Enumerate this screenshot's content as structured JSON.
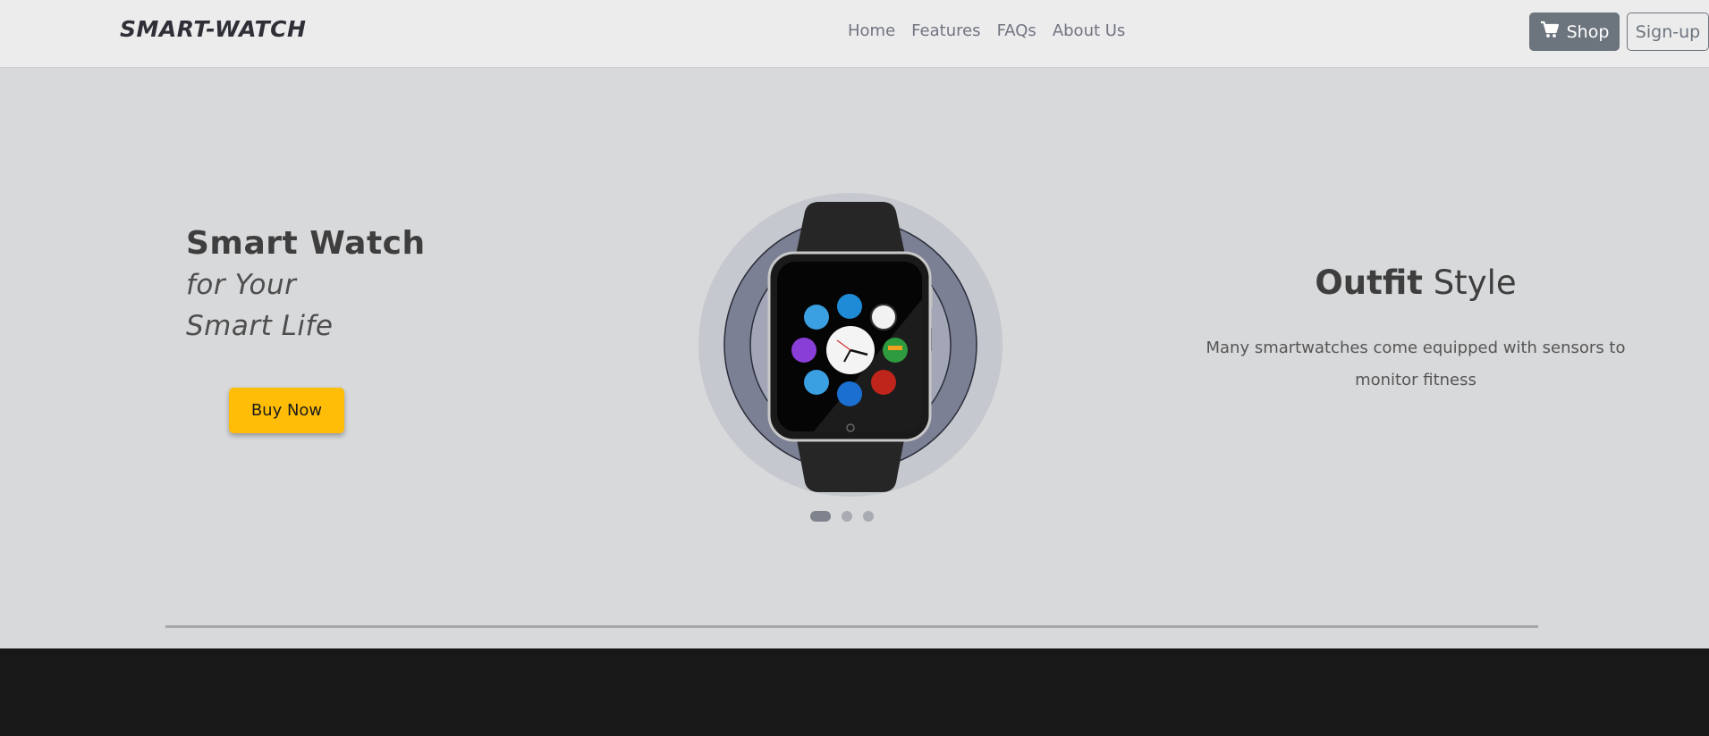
{
  "nav": {
    "brand": "SMART-WATCH",
    "links": [
      "Home",
      "Features",
      "FAQs",
      "About Us"
    ],
    "shop_label": "Shop",
    "signup_label": "Sign-up"
  },
  "hero": {
    "title": "Smart Watch",
    "subtitle_line1": "for Your",
    "subtitle_line2": "Smart Life",
    "buy_label": "Buy Now",
    "right_title_bold": "Outfit",
    "right_title_rest": " Style",
    "right_desc_line1": "Many smartwatches come equipped with sensors to",
    "right_desc_line2": "monitor fitness",
    "slides": {
      "count": 3,
      "active": 1
    }
  },
  "icons": [
    "cart-icon",
    "smartwatch-image"
  ],
  "colors": {
    "accent": "#ffbd07",
    "shop_button": "#6c747d",
    "footer": "#181818",
    "hero_bg": "#d8d9db"
  }
}
